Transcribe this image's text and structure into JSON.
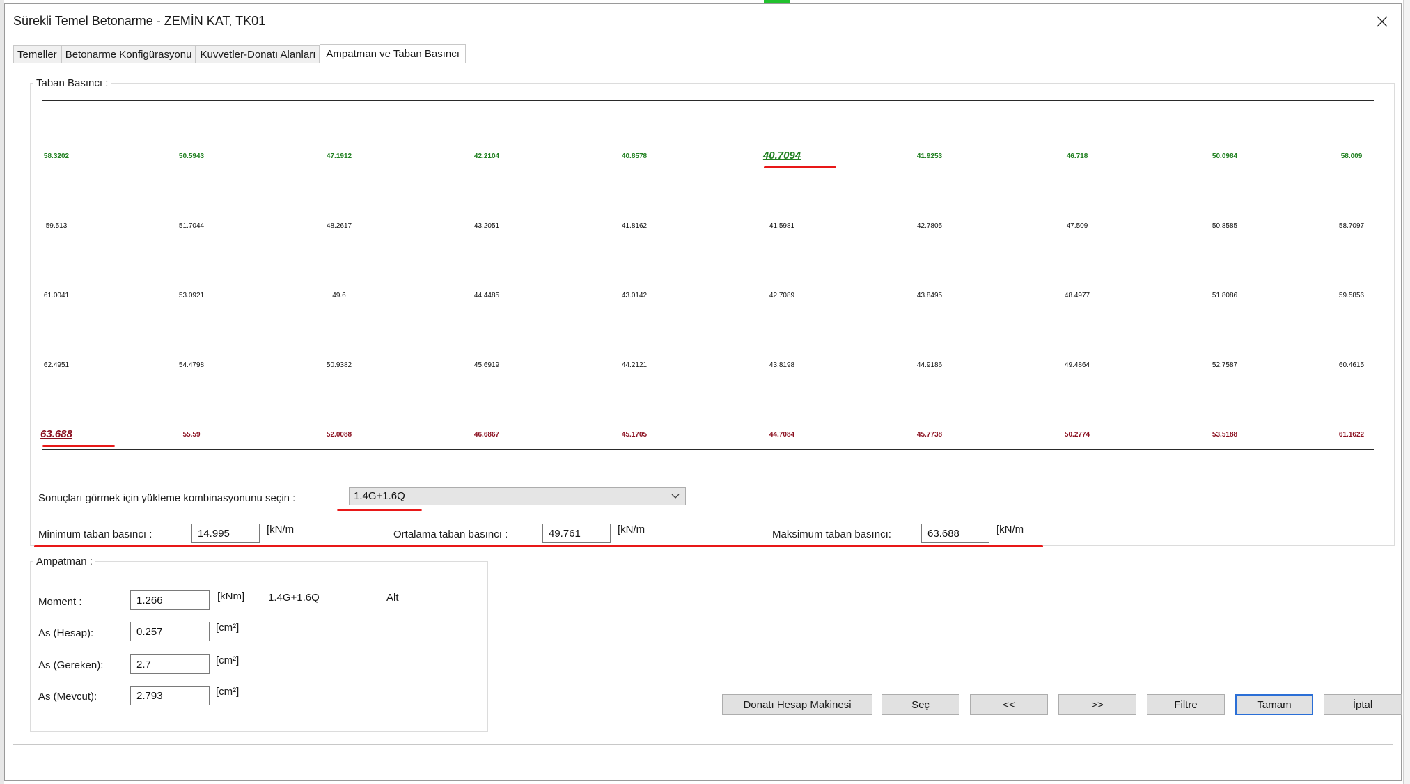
{
  "window": {
    "title": "Sürekli Temel Betonarme - ZEMİN KAT, TK01"
  },
  "tabs": [
    {
      "label": "Temeller"
    },
    {
      "label": "Betonarme Konfigürasyonu"
    },
    {
      "label": "Kuvvetler-Donatı Alanları"
    },
    {
      "label": "Ampatman ve Taban Basıncı"
    }
  ],
  "taban": {
    "title": "Taban Basıncı :",
    "grid": [
      [
        "58.3202",
        "50.5943",
        "47.1912",
        "42.2104",
        "40.8578",
        "40.7094",
        "41.9253",
        "46.718",
        "50.0984",
        "58.009"
      ],
      [
        "59.513",
        "51.7044",
        "48.2617",
        "43.2051",
        "41.8162",
        "41.5981",
        "42.7805",
        "47.509",
        "50.8585",
        "58.7097"
      ],
      [
        "61.0041",
        "53.0921",
        "49.6",
        "44.4485",
        "43.0142",
        "42.7089",
        "43.8495",
        "48.4977",
        "51.8086",
        "59.5856"
      ],
      [
        "62.4951",
        "54.4798",
        "50.9382",
        "45.6919",
        "44.2121",
        "43.8198",
        "44.9186",
        "49.4864",
        "52.7587",
        "60.4615"
      ],
      [
        "63.688",
        "55.59",
        "52.0088",
        "46.6867",
        "45.1705",
        "44.7084",
        "45.7738",
        "50.2774",
        "53.5188",
        "61.1622"
      ]
    ],
    "combo_label": "Sonuçları görmek için yükleme kombinasyonunu seçin :",
    "combo_value": "1.4G+1.6Q",
    "min_label": "Minimum taban basıncı :",
    "min_value": "14.995",
    "avg_label": "Ortalama taban basıncı :",
    "avg_value": "49.761",
    "max_label": "Maksimum taban basıncı:",
    "max_value": "63.688",
    "unit": "[kN/m"
  },
  "ampatman": {
    "title": "Ampatman :",
    "moment_label": "Moment :",
    "moment_value": "1.266",
    "moment_unit": "[kNm]",
    "moment_combo": "1.4G+1.6Q",
    "moment_side": "Alt",
    "as_hesap_label": "As (Hesap):",
    "as_hesap_value": "0.257",
    "as_gereken_label": "As (Gereken):",
    "as_gereken_value": "2.7",
    "as_mevcut_label": "As (Mevcut):",
    "as_mevcut_value": "2.793",
    "cm2_unit": "[cm²]"
  },
  "buttons": {
    "donati": "Donatı Hesap Makinesi",
    "sec": "Seç",
    "prev": "<<",
    "next": ">>",
    "filtre": "Filtre",
    "tamam": "Tamam",
    "iptal": "İptal"
  },
  "colors": {
    "min_row": "#208020",
    "max_row": "#8b1020",
    "highlight": "#e81818"
  }
}
